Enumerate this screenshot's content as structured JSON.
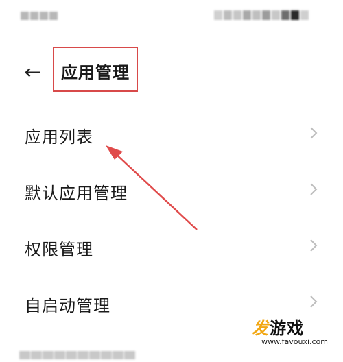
{
  "header": {
    "title": "应用管理",
    "back_icon": "←"
  },
  "menu": {
    "items": [
      {
        "label": "应用列表"
      },
      {
        "label": "默认应用管理"
      },
      {
        "label": "权限管理"
      },
      {
        "label": "自启动管理"
      }
    ]
  },
  "watermark": {
    "logo": "发",
    "name": "游戏",
    "url": "www.favouxi.com"
  },
  "colors": {
    "highlight_border": "#d84a4a",
    "arrow": "#e04b4b",
    "chevron": "#bdbdbd",
    "watermark_logo": "#f2a713"
  }
}
